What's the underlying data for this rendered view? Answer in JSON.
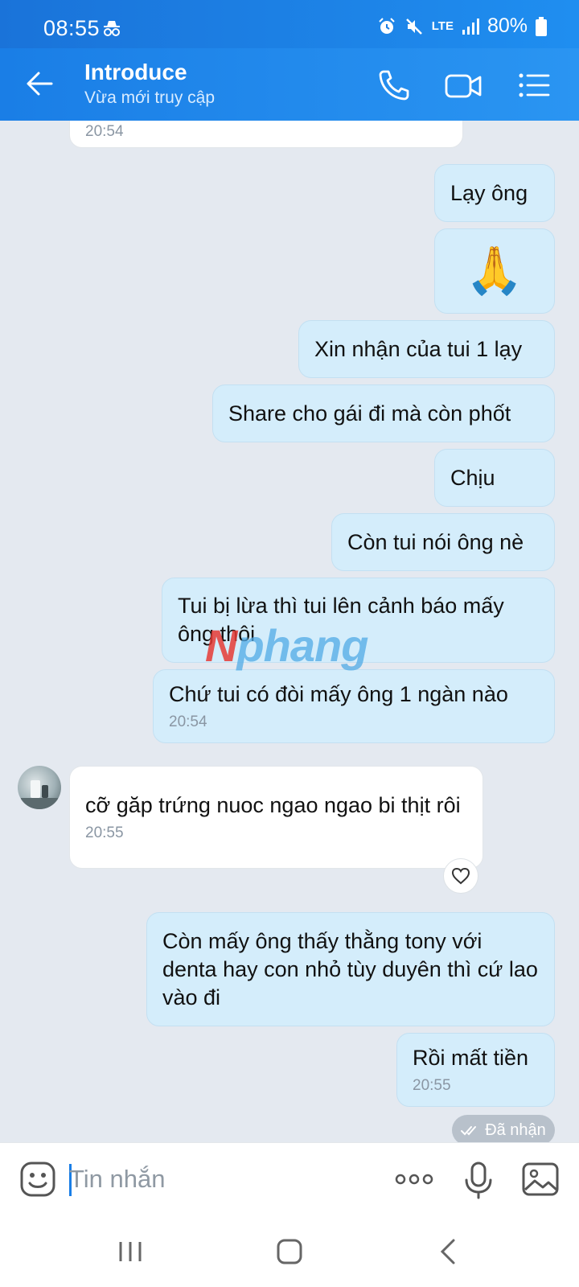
{
  "status_bar": {
    "time": "08:55",
    "network": "LTE",
    "battery": "80%"
  },
  "header": {
    "title": "Introduce",
    "subtitle": "Vừa mới truy cập"
  },
  "messages": [
    {
      "dir": "in",
      "text": "",
      "time": "20:54"
    },
    {
      "dir": "out",
      "text": "Lạy ông"
    },
    {
      "dir": "out",
      "text": "🙏"
    },
    {
      "dir": "out",
      "text": "Xin nhận của tui 1 lạy"
    },
    {
      "dir": "out",
      "text": "Share cho gái đi mà còn phốt"
    },
    {
      "dir": "out",
      "text": "Chịu"
    },
    {
      "dir": "out",
      "text": "Còn tui nói ông nè"
    },
    {
      "dir": "out",
      "text": "Tui bị lừa thì tui lên cảnh báo mấy ông thôi"
    },
    {
      "dir": "out",
      "text": "Chứ tui có đòi mấy ông 1 ngàn nào",
      "time": "20:54"
    },
    {
      "dir": "in",
      "text": "cỡ găp trứng nuoc ngao ngao bi thịt rôi",
      "time": "20:55"
    },
    {
      "dir": "out",
      "text": "Còn mấy ông thấy thằng tony với denta hay con nhỏ tùy duyên thì cứ lao vào đi"
    },
    {
      "dir": "out",
      "text": "Rồi mất tiền",
      "time": "20:55"
    }
  ],
  "seen_label": "Đã nhận",
  "watermark": {
    "part1": "N",
    "part2": "phang"
  },
  "composer": {
    "placeholder": "Tin nhắn"
  },
  "colors": {
    "header": "#1a7ee6",
    "outgoing_bubble": "#d4edfb",
    "incoming_bubble": "#ffffff",
    "background": "#e4e9f0"
  }
}
